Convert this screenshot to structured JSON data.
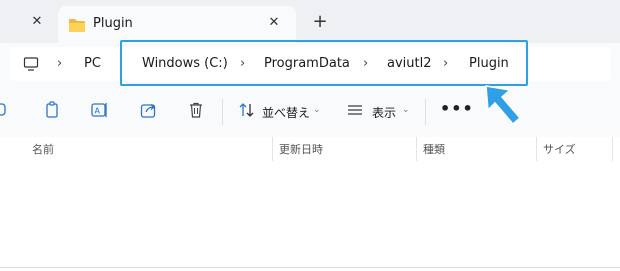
{
  "tabs": {
    "active_title": "Plugin",
    "close_glyph": "✕",
    "new_tab_glyph": "+"
  },
  "address": {
    "root": "PC",
    "crumbs": [
      "Windows (C:)",
      "ProgramData",
      "aviutl2",
      "Plugin"
    ],
    "separator": "›"
  },
  "toolbar": {
    "sort_label": "並べ替え",
    "view_label": "表示",
    "more_label": "•••",
    "chevron": "⌄"
  },
  "columns": [
    "名前",
    "更新日時",
    "種類",
    "サイズ"
  ],
  "annotation": {
    "highlight_color": "#2f9fe6",
    "arrow_color": "#2f9fe6"
  }
}
